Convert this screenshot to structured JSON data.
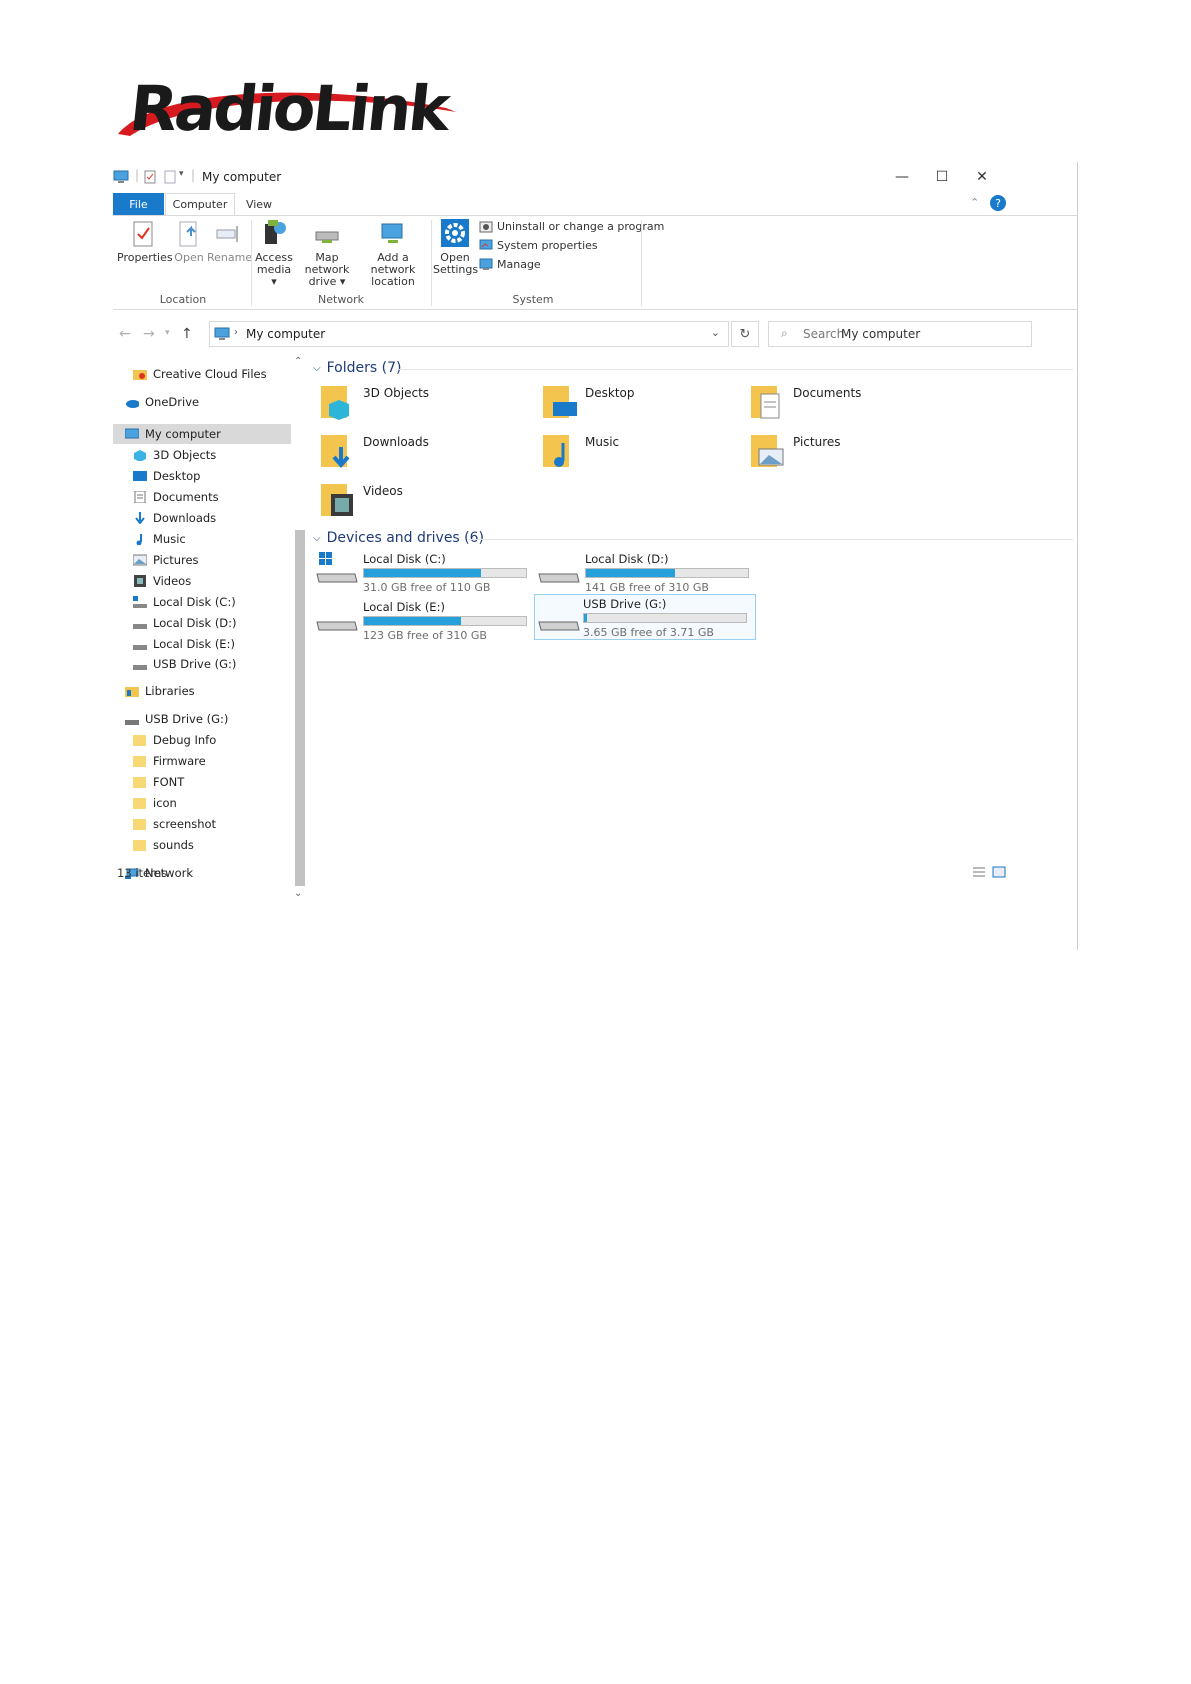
{
  "brand": {
    "logo_text": "RadioLink"
  },
  "window": {
    "title": "My computer",
    "controls": {
      "minimize": "—",
      "maximize": "☐",
      "close": "✕"
    },
    "help": "?"
  },
  "tabs": {
    "file": "File",
    "computer": "Computer",
    "view": "View"
  },
  "ribbon": {
    "location": {
      "label": "Location",
      "properties": "Properties",
      "open": "Open",
      "rename": "Rename"
    },
    "network": {
      "label": "Network",
      "access_media_1": "Access",
      "access_media_2": "media ▾",
      "map_drive_1": "Map network",
      "map_drive_2": "drive ▾",
      "add_location_1": "Add a network",
      "add_location_2": "location"
    },
    "system": {
      "label": "System",
      "open_settings_1": "Open",
      "open_settings_2": "Settings",
      "uninstall": "Uninstall or change a program",
      "system_properties": "System properties",
      "manage": "Manage"
    }
  },
  "address": {
    "path": "My computer",
    "search_placeholder": "Search",
    "search_scope": "My computer"
  },
  "sidebar": {
    "items": [
      {
        "label": "Creative Cloud Files"
      },
      {
        "label": "OneDrive"
      },
      {
        "label": "My computer"
      },
      {
        "label": "3D Objects"
      },
      {
        "label": "Desktop"
      },
      {
        "label": "Documents"
      },
      {
        "label": "Downloads"
      },
      {
        "label": "Music"
      },
      {
        "label": "Pictures"
      },
      {
        "label": "Videos"
      },
      {
        "label": "Local Disk (C:)"
      },
      {
        "label": "Local Disk (D:)"
      },
      {
        "label": "Local Disk (E:)"
      },
      {
        "label": "USB Drive (G:)"
      },
      {
        "label": "Libraries"
      },
      {
        "label": "USB Drive (G:)"
      },
      {
        "label": "Debug Info"
      },
      {
        "label": "Firmware"
      },
      {
        "label": "FONT"
      },
      {
        "label": "icon"
      },
      {
        "label": "screenshot"
      },
      {
        "label": "sounds"
      },
      {
        "label": "Network"
      }
    ]
  },
  "main": {
    "folders_header": "Folders (7)",
    "folders": [
      {
        "name": "3D Objects"
      },
      {
        "name": "Desktop"
      },
      {
        "name": "Documents"
      },
      {
        "name": "Downloads"
      },
      {
        "name": "Music"
      },
      {
        "name": "Pictures"
      },
      {
        "name": "Videos"
      }
    ],
    "drives_header": "Devices and drives (6)",
    "drives": [
      {
        "name": "Local Disk (C:)",
        "free": "31.0 GB free of 110 GB",
        "used_fraction": 0.72
      },
      {
        "name": "Local Disk (D:)",
        "free": "141 GB free of 310 GB",
        "used_fraction": 0.55
      },
      {
        "name": "Local Disk (E:)",
        "free": "123 GB free of 310 GB",
        "used_fraction": 0.6
      },
      {
        "name": "USB Drive (G:)",
        "free": "3.65 GB free of 3.71 GB",
        "used_fraction": 0.02
      }
    ]
  },
  "status": {
    "items": "13 items"
  },
  "colors": {
    "accent": "#1979ca",
    "bar_fill": "#26a0da",
    "folder": "#f3c54e"
  }
}
